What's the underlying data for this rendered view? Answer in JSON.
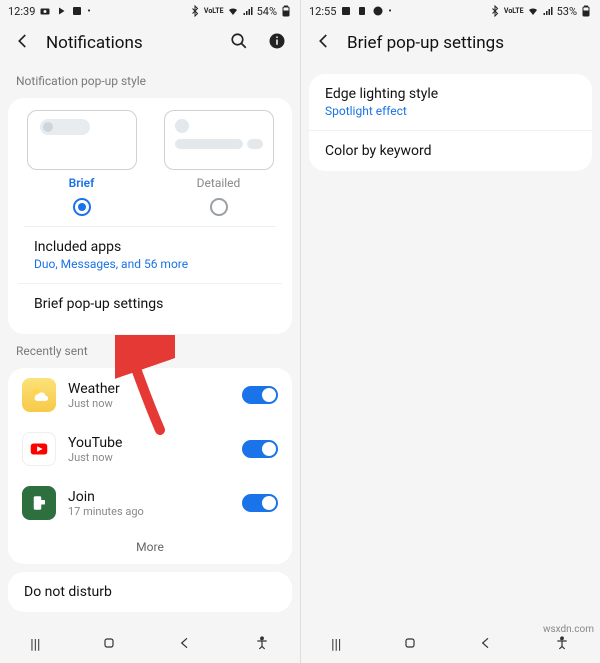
{
  "left": {
    "status": {
      "time": "12:39",
      "battery": "54%"
    },
    "header": {
      "title": "Notifications"
    },
    "popup_style": {
      "label": "Notification pop-up style",
      "brief": "Brief",
      "detailed": "Detailed"
    },
    "included": {
      "title": "Included apps",
      "sub": "Duo, Messages, and 56 more"
    },
    "brief_settings": "Brief pop-up settings",
    "recently_sent": "Recently sent",
    "recent": [
      {
        "name": "Weather",
        "sub": "Just now"
      },
      {
        "name": "YouTube",
        "sub": "Just now"
      },
      {
        "name": "Join",
        "sub": "17 minutes ago"
      }
    ],
    "more": "More",
    "dnd": "Do not disturb"
  },
  "right": {
    "status": {
      "time": "12:55",
      "battery": "53%"
    },
    "header": {
      "title": "Brief pop-up settings"
    },
    "items": [
      {
        "title": "Edge lighting style",
        "sub": "Spotlight effect"
      },
      {
        "title": "Color by keyword",
        "sub": ""
      }
    ]
  },
  "watermark": "wsxdn.com"
}
